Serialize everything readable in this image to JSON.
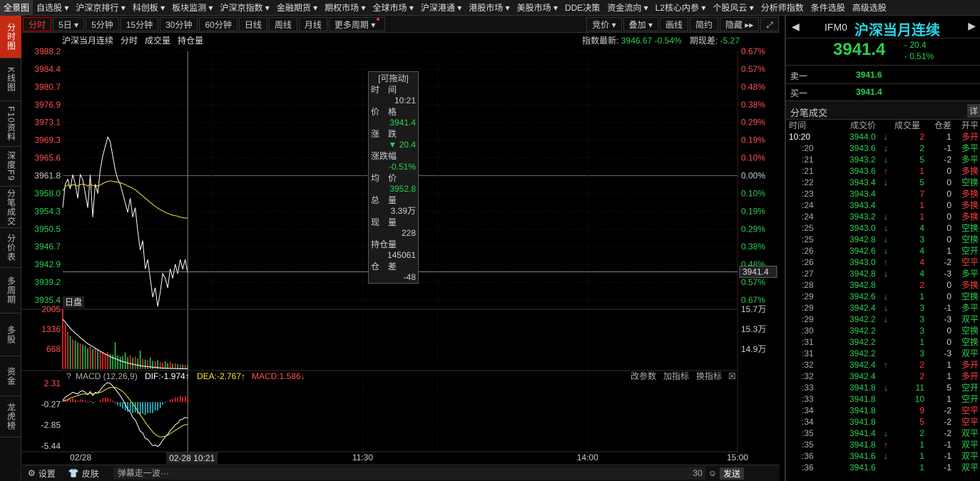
{
  "menu": [
    "全景图",
    "自选股 ▾",
    "沪深京排行 ▾",
    "科创板 ▾",
    "板块监测 ▾",
    "沪深京指数 ▾",
    "金融期货 ▾",
    "期权市场 ▾",
    "全球市场 ▾",
    "沪深港通 ▾",
    "港股市场 ▾",
    "美股市场 ▾",
    "DDE决策",
    "资金流向 ▾",
    "L2核心内参 ▾",
    "个股风云 ▾",
    "分析师指数",
    "条件选股",
    "高级选股"
  ],
  "left_tabs": [
    "分时图",
    "K线图",
    "F10资料",
    "深度F9",
    "分笔成交",
    "分价表",
    "多周期",
    "多股",
    "资金",
    "龙虎榜"
  ],
  "toolbar": {
    "items": [
      "分时",
      "5日 ▾",
      "5分钟",
      "15分钟",
      "30分钟",
      "60分钟",
      "日线",
      "周线",
      "月线",
      "更多周期 ▾"
    ],
    "right": [
      "竞价 ▾",
      "叠加 ▾",
      "画线",
      "简约",
      "隐藏 ▸▸",
      "⤢"
    ]
  },
  "info": {
    "name": "沪深当月连续",
    "tabs": [
      "分时",
      "成交量",
      "持仓量"
    ],
    "index_label": "指数最新:",
    "index_value": "3946.67",
    "index_pct": "-0.54%",
    "basis_label": "期现差:",
    "basis_value": "-5.27"
  },
  "chart_data": {
    "type": "line",
    "price_ticks": [
      "3988.2",
      "3984.4",
      "3980.7",
      "3976.9",
      "3973.1",
      "3969.3",
      "3965.6",
      "3961.8",
      "3958.0",
      "3954.3",
      "3950.5",
      "3946.7",
      "3942.9",
      "3939.2",
      "3935.4"
    ],
    "pct_ticks": [
      "0.67%",
      "0.57%",
      "0.48%",
      "0.38%",
      "0.29%",
      "0.19%",
      "0.10%",
      "0.00%",
      "0.10%",
      "0.19%",
      "0.29%",
      "0.38%",
      "0.48%",
      "0.57%",
      "0.67%"
    ],
    "ylim": [
      3935.4,
      3988.2
    ],
    "x_labels": [
      "02/28",
      "11:30",
      "14:00",
      "15:00"
    ],
    "cursor_time": "02-28 10:21",
    "cursor_price": "3941.4",
    "price": [
      3955,
      3960,
      3961,
      3959,
      3962,
      3960,
      3957,
      3962,
      3961,
      3958,
      3955,
      3962,
      3953,
      3960,
      3958,
      3963,
      3966,
      3968,
      3970,
      3969,
      3966,
      3963,
      3961,
      3960,
      3958,
      3956,
      3954,
      3957,
      3953,
      3955,
      3950,
      3946,
      3948,
      3942,
      3944,
      3940,
      3936,
      3938,
      3934,
      3937,
      3941,
      3940,
      3938,
      3942,
      3940,
      3943,
      3941,
      3944,
      3942,
      3944,
      3941
    ],
    "avg": [
      3958.5,
      3959.5,
      3959.8,
      3959.6,
      3959.9,
      3959.8,
      3959.6,
      3959.9,
      3960.0,
      3959.9,
      3959.6,
      3960.0,
      3959.7,
      3959.7,
      3959.6,
      3959.8,
      3960.1,
      3960.4,
      3960.6,
      3960.7,
      3960.6,
      3960.5,
      3960.4,
      3960.3,
      3960.1,
      3959.9,
      3959.6,
      3959.4,
      3959.1,
      3958.8,
      3958.4,
      3957.9,
      3957.5,
      3957.0,
      3956.6,
      3956.1,
      3955.7,
      3955.3,
      3954.9,
      3954.6,
      3954.3,
      3954.0,
      3953.8,
      3953.6,
      3953.4,
      3953.3,
      3953.2,
      3953.0,
      3952.9,
      3952.8,
      3952.8
    ],
    "volume": [
      2005,
      1500,
      1250,
      1100,
      1000,
      950,
      900,
      850,
      820,
      780,
      700,
      760,
      680,
      720,
      650,
      600,
      580,
      520,
      560,
      500,
      480,
      900,
      460,
      420,
      440,
      560,
      400,
      460,
      380,
      420,
      360,
      620,
      340,
      320,
      300,
      380,
      280,
      260,
      300,
      240,
      220,
      260,
      200,
      240,
      180,
      200,
      170,
      160,
      150,
      140,
      130
    ],
    "volume_ticks": [
      "2005",
      "1336",
      "668"
    ],
    "oi_ticks": [
      "15.7万",
      "15.3万",
      "14.9万"
    ],
    "oi": [
      155000,
      154400,
      153800,
      153200,
      152700,
      152200,
      151800,
      151300,
      150900,
      150500,
      150100,
      149800,
      149500,
      149200,
      148900,
      148600,
      148300,
      148000,
      147800,
      147500,
      147300,
      147100,
      146900,
      146700,
      146500,
      146400,
      146200,
      146100,
      146000,
      145900,
      145800,
      145700,
      145600,
      145550,
      145500,
      145450,
      145400,
      145350,
      145300,
      145250,
      145200,
      145180,
      145160,
      145140,
      145120,
      145100,
      145090,
      145080,
      145070,
      145065,
      145061
    ],
    "macd_ticks": [
      "2.31",
      "-0.27",
      "-2.85",
      "-5.44"
    ],
    "macd": {
      "dif": [
        0.2,
        0.6,
        0.8,
        1.0,
        1.2,
        1.1,
        1.0,
        1.3,
        1.4,
        1.2,
        0.9,
        1.3,
        0.8,
        1.2,
        1.1,
        1.5,
        1.9,
        2.2,
        2.4,
        2.3,
        2.0,
        1.6,
        1.2,
        0.8,
        0.3,
        -0.3,
        -0.9,
        -1.2,
        -1.9,
        -2.2,
        -2.9,
        -3.6,
        -3.8,
        -4.5,
        -4.6,
        -5.0,
        -5.4,
        -5.3,
        -5.5,
        -5.2,
        -4.7,
        -4.3,
        -4.0,
        -3.5,
        -3.2,
        -2.8,
        -2.6,
        -2.2,
        -2.1,
        -1.9,
        -1.97
      ],
      "dea": [
        0.1,
        0.2,
        0.3,
        0.5,
        0.6,
        0.7,
        0.8,
        0.9,
        1.0,
        1.0,
        1.0,
        1.1,
        1.0,
        1.1,
        1.1,
        1.2,
        1.3,
        1.5,
        1.7,
        1.8,
        1.8,
        1.8,
        1.7,
        1.5,
        1.3,
        1.0,
        0.6,
        0.2,
        -0.2,
        -0.6,
        -1.1,
        -1.6,
        -2.0,
        -2.5,
        -2.9,
        -3.3,
        -3.7,
        -4.0,
        -4.2,
        -4.3,
        -4.3,
        -4.2,
        -4.1,
        -3.9,
        -3.7,
        -3.5,
        -3.3,
        -3.1,
        -2.9,
        -2.8,
        -2.767
      ]
    },
    "macd_labels": {
      "title": "MACD (12,26,9)",
      "dif": "DIF:-1.974↑",
      "dea": "DEA:-2.767↑",
      "macd": "MACD:1.586↓"
    },
    "macd_actions": [
      "改参数",
      "加指标",
      "换指标"
    ],
    "day_label": "日盘"
  },
  "tooltip": {
    "title": "[可拖动]",
    "time_label": "时　间",
    "time": "10:21",
    "price_label": "价　格",
    "price": "3941.4",
    "chg_label": "涨　跌",
    "chg": "▼ 20.4",
    "pct_label": "涨跌幅",
    "pct": "-0.51%",
    "avg_label": "均　价",
    "avg": "3952.8",
    "vol_label": "总　量",
    "vol": "3.39万",
    "cur_label": "现　量",
    "cur": "228",
    "oi_label": "持仓量",
    "oi": "145061",
    "diff_label": "仓　差",
    "diff": "-48"
  },
  "right": {
    "code": "IFM0",
    "name": "沪深当月连续",
    "price": "3941.4",
    "chg": "- 20.4",
    "pct": "- 0.51%",
    "sell_label": "卖一",
    "sell": "3941.6",
    "buy_label": "买一",
    "buy": "3941.4",
    "ticks_title": "分笔成交",
    "detail": "详",
    "headers": [
      "时间",
      "成交价",
      "成交量",
      "仓差",
      "开平"
    ]
  },
  "trades": [
    [
      "10:20",
      "3944.0",
      "↓",
      "2",
      "1",
      "多开",
      "r"
    ],
    [
      ":20",
      "3943.6",
      "↓",
      "2",
      "-1",
      "多平",
      "g"
    ],
    [
      ":21",
      "3943.2",
      "↓",
      "5",
      "-2",
      "多平",
      "g"
    ],
    [
      ":21",
      "3943.6",
      "↑",
      "1",
      "0",
      "多换",
      "r"
    ],
    [
      ":22",
      "3943.4",
      "↓",
      "5",
      "0",
      "空换",
      "g"
    ],
    [
      ":23",
      "3943.4",
      "",
      "7",
      "0",
      "多换",
      "r"
    ],
    [
      ":24",
      "3943.4",
      "",
      "1",
      "0",
      "多换",
      "r"
    ],
    [
      ":24",
      "3943.2",
      "↓",
      "1",
      "0",
      "多换",
      "r"
    ],
    [
      ":25",
      "3943.0",
      "↓",
      "4",
      "0",
      "空换",
      "g"
    ],
    [
      ":25",
      "3942.8",
      "↓",
      "3",
      "0",
      "空换",
      "g"
    ],
    [
      ":26",
      "3942.6",
      "↓",
      "4",
      "1",
      "空开",
      "g"
    ],
    [
      ":26",
      "3943.0",
      "↑",
      "4",
      "-2",
      "空平",
      "r"
    ],
    [
      ":27",
      "3942.8",
      "↓",
      "4",
      "-3",
      "多平",
      "g"
    ],
    [
      ":28",
      "3942.8",
      "",
      "2",
      "0",
      "多换",
      "r"
    ],
    [
      ":29",
      "3942.6",
      "↓",
      "1",
      "0",
      "空换",
      "g"
    ],
    [
      ":29",
      "3942.4",
      "↓",
      "3",
      "-1",
      "多平",
      "g"
    ],
    [
      ":29",
      "3942.2",
      "↓",
      "3",
      "-3",
      "双平",
      "g"
    ],
    [
      ":30",
      "3942.2",
      "",
      "3",
      "0",
      "空换",
      "g"
    ],
    [
      ":31",
      "3942.2",
      "",
      "1",
      "0",
      "空换",
      "g"
    ],
    [
      ":31",
      "3942.2",
      "",
      "3",
      "-3",
      "双平",
      "g"
    ],
    [
      ":32",
      "3942.4",
      "↑",
      "2",
      "1",
      "多开",
      "r"
    ],
    [
      ":32",
      "3942.4",
      "",
      "2",
      "1",
      "多开",
      "r"
    ],
    [
      ":33",
      "3941.8",
      "↓",
      "11",
      "5",
      "空开",
      "g"
    ],
    [
      ":33",
      "3941.8",
      "",
      "10",
      "1",
      "空开",
      "g"
    ],
    [
      ":34",
      "3941.8",
      "",
      "9",
      "-2",
      "空平",
      "r"
    ],
    [
      ":34",
      "3941.8",
      "",
      "5",
      "-2",
      "空平",
      "r"
    ],
    [
      ":35",
      "3941.4",
      "↓",
      "2",
      "-2",
      "双平",
      "g"
    ],
    [
      ":35",
      "3941.8",
      "↑",
      "1",
      "-1",
      "双平",
      "g"
    ],
    [
      ":36",
      "3941.6",
      "↓",
      "1",
      "-1",
      "双平",
      "g"
    ],
    [
      ":36",
      "3941.6",
      "",
      "1",
      "-1",
      "双平",
      "g"
    ]
  ],
  "bottom": {
    "settings": "设置",
    "skin": "皮肤",
    "danmu": "弹幕走一波···",
    "count": "30",
    "send": "发送"
  }
}
